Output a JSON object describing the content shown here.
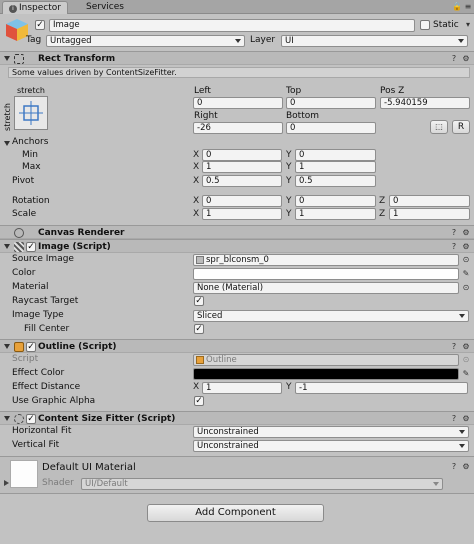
{
  "tabs": [
    {
      "label": "Inspector"
    },
    {
      "label": "Services"
    }
  ],
  "header": {
    "name": "Image",
    "static_label": "Static",
    "tag_label": "Tag",
    "tag_value": "Untagged",
    "layer_label": "Layer",
    "layer_value": "UI"
  },
  "rect_transform": {
    "title": "Rect Transform",
    "note": "Some values driven by ContentSizeFitter.",
    "stretch_h": "stretch",
    "stretch_v": "stretch",
    "col_left": "Left",
    "col_top": "Top",
    "col_posz": "Pos Z",
    "left": "0",
    "top": "0",
    "posz": "-5.940159",
    "col_right": "Right",
    "col_bottom": "Bottom",
    "right": "-26",
    "bottom": "0",
    "r_button": "R",
    "anchors": "Anchors",
    "min": "Min",
    "max": "Max",
    "pivot": "Pivot",
    "rotation": "Rotation",
    "scale": "Scale",
    "x": "X",
    "y": "Y",
    "z": "Z",
    "min_x": "0",
    "min_y": "0",
    "max_x": "1",
    "max_y": "1",
    "pivot_x": "0.5",
    "pivot_y": "0.5",
    "rot_x": "0",
    "rot_y": "0",
    "rot_z": "0",
    "scale_x": "1",
    "scale_y": "1",
    "scale_z": "1"
  },
  "canvas_renderer": {
    "title": "Canvas Renderer"
  },
  "image_script": {
    "title": "Image (Script)",
    "source_image_label": "Source Image",
    "source_image": "spr_blconsm_0",
    "color_label": "Color",
    "color_value": "#ffffff",
    "material_label": "Material",
    "material": "None (Material)",
    "raycast_label": "Raycast Target",
    "image_type_label": "Image Type",
    "image_type": "Sliced",
    "fill_center_label": "Fill Center"
  },
  "outline_script": {
    "title": "Outline (Script)",
    "script_label": "Script",
    "script_value": "Outline",
    "effect_color_label": "Effect Color",
    "effect_color": "#000000",
    "effect_distance_label": "Effect Distance",
    "dist_x": "1",
    "dist_y": "-1",
    "graphic_alpha_label": "Use Graphic Alpha"
  },
  "content_size_fitter": {
    "title": "Content Size Fitter (Script)",
    "h_fit_label": "Horizontal Fit",
    "h_fit": "Unconstrained",
    "v_fit_label": "Vertical Fit",
    "v_fit": "Unconstrained"
  },
  "material": {
    "name": "Default UI Material",
    "shader_label": "Shader",
    "shader": "UI/Default"
  },
  "add_component": "Add Component",
  "checkmark": "✓",
  "colors": {
    "accent_blue": "#3d78c4",
    "outline_orange": "#e8a13a"
  }
}
